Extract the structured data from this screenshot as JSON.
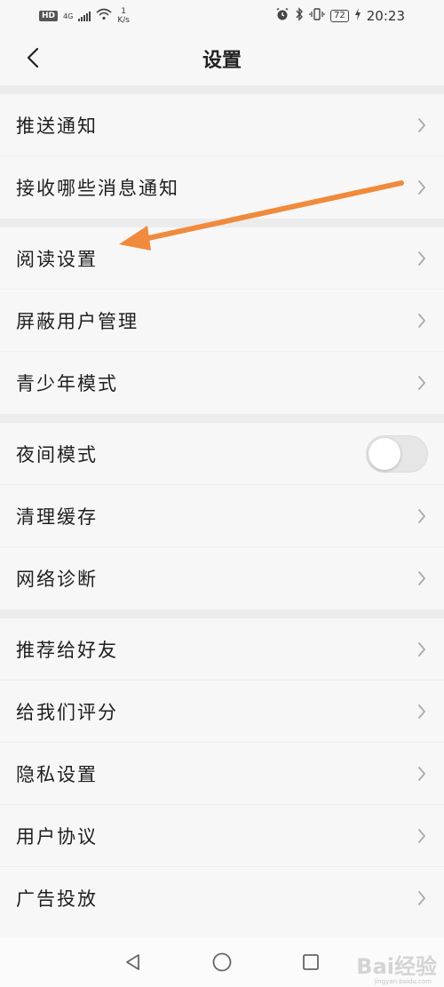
{
  "status_bar": {
    "hd_badge": "HD",
    "network_type": "4G",
    "net_speed_value": "1",
    "net_speed_unit": "K/s",
    "battery": "72",
    "time": "20:23"
  },
  "header": {
    "title": "设置",
    "back_icon": "chevron-left-icon"
  },
  "groups": [
    {
      "items": [
        {
          "label": "推送通知",
          "control": "chevron"
        },
        {
          "label": "接收哪些消息通知",
          "control": "chevron"
        }
      ]
    },
    {
      "items": [
        {
          "label": "阅读设置",
          "control": "chevron"
        },
        {
          "label": "屏蔽用户管理",
          "control": "chevron"
        },
        {
          "label": "青少年模式",
          "control": "chevron"
        }
      ]
    },
    {
      "items": [
        {
          "label": "夜间模式",
          "control": "toggle",
          "toggle_on": false
        },
        {
          "label": "清理缓存",
          "control": "chevron"
        },
        {
          "label": "网络诊断",
          "control": "chevron"
        }
      ]
    },
    {
      "items": [
        {
          "label": "推荐给好友",
          "control": "chevron"
        },
        {
          "label": "给我们评分",
          "control": "chevron"
        },
        {
          "label": "隐私设置",
          "control": "chevron"
        },
        {
          "label": "用户协议",
          "control": "chevron"
        },
        {
          "label": "广告投放",
          "control": "chevron"
        }
      ]
    }
  ],
  "annotation": {
    "color": "#f08a3c",
    "points_to": "阅读设置"
  },
  "nav_bar": {
    "back": "triangle-back-icon",
    "home": "circle-home-icon",
    "recents": "square-recents-icon"
  },
  "watermark": {
    "text": "Bai经验",
    "sub": "jingyan.baidu.com"
  }
}
